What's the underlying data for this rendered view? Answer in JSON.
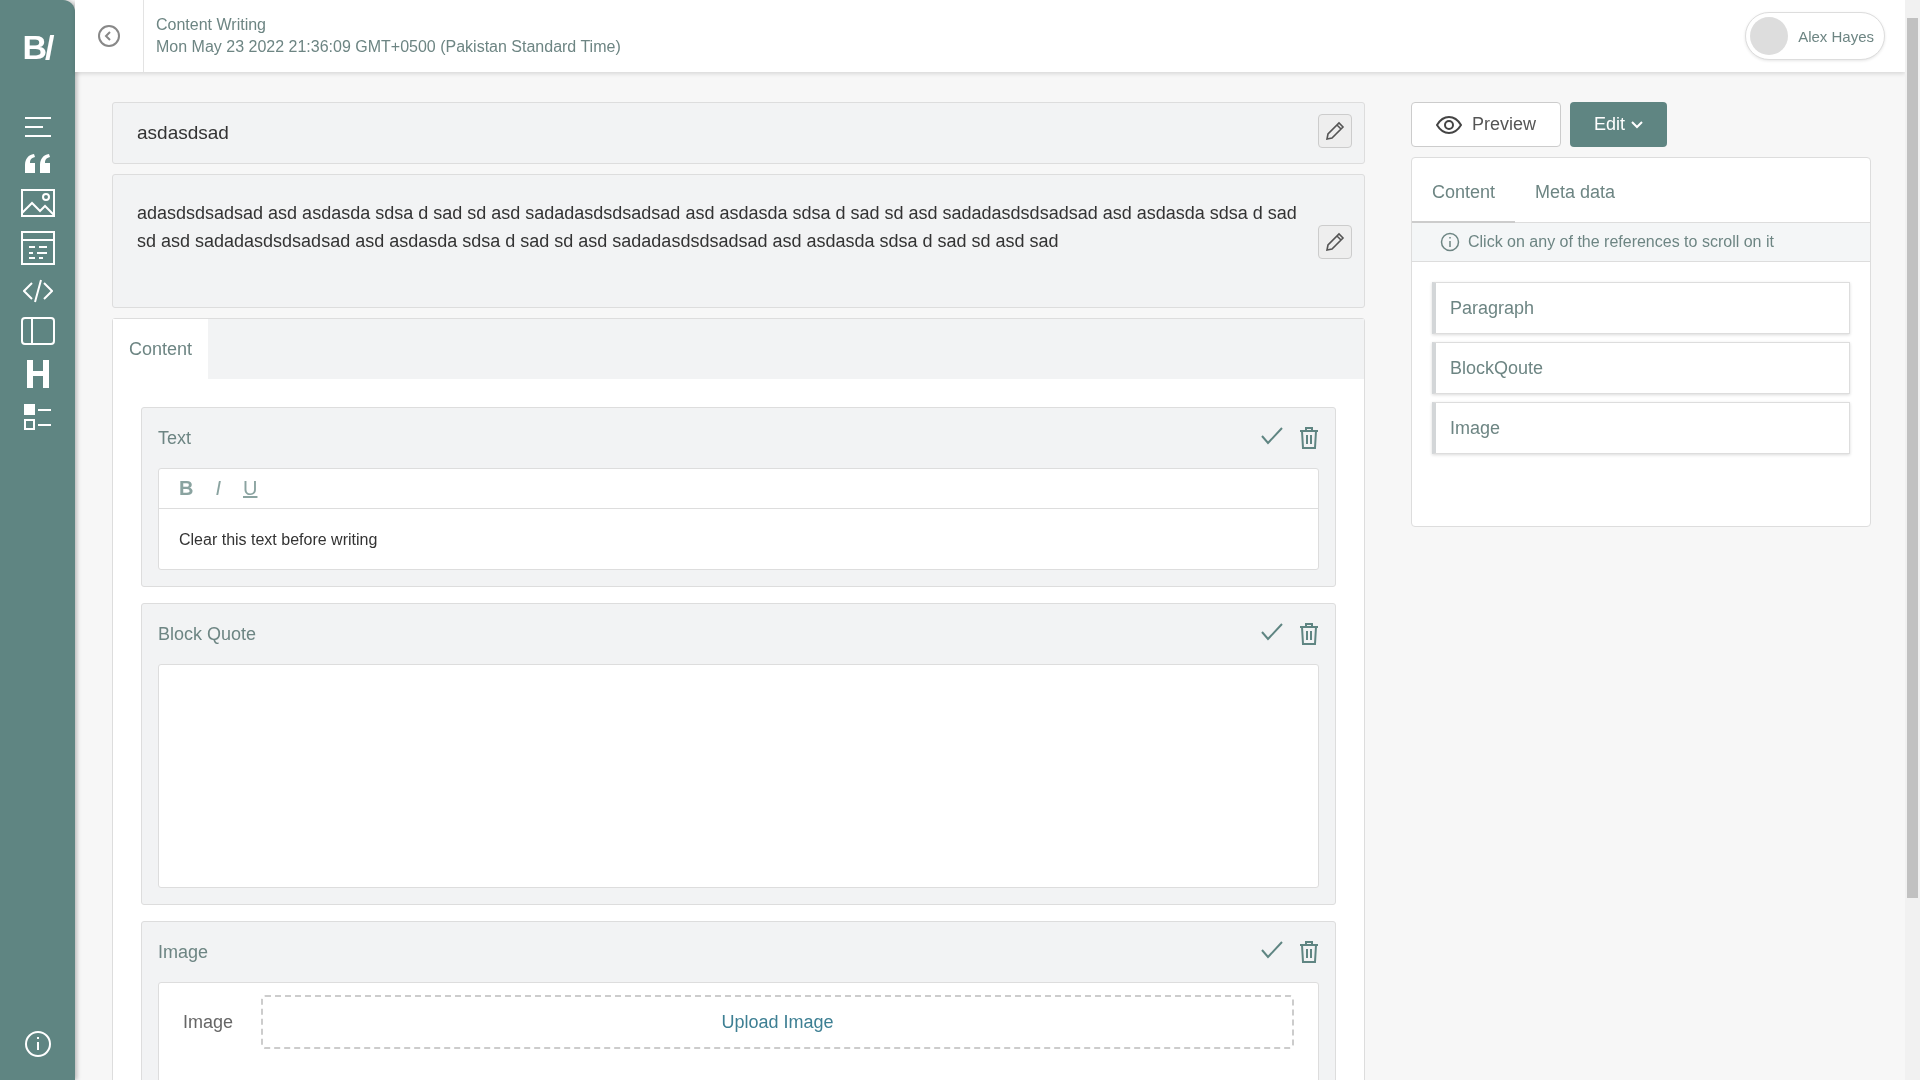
{
  "sidebar": {
    "logo": "B/"
  },
  "header": {
    "title": "Content Writing",
    "timestamp": "Mon May 23 2022 21:36:09 GMT+0500 (Pakistan Standard Time)",
    "user": "Alex Hayes"
  },
  "document": {
    "title": "asdasdsad",
    "description": "adasdsdsadsad asd asdasda sdsa d sad sd asd sadadasdsdsadsad asd asdasda sdsa d sad sd asd sadadasdsdsadsad asd asdasda sdsa d sad sd asd sadadasdsdsadsad asd asdasda sdsa d sad sd asd sadadasdsdsadsad asd asdasda sdsa d sad sd asd sad"
  },
  "editor_tabs": [
    {
      "label": "Content",
      "selected": true
    }
  ],
  "blocks": [
    {
      "kind": "text",
      "title": "Text",
      "format_buttons": [
        "B",
        "I",
        "U"
      ],
      "value": "Clear this text before writing"
    },
    {
      "kind": "quote",
      "title": "Block Quote"
    },
    {
      "kind": "image",
      "title": "Image",
      "field_label": "Image",
      "upload": "Upload Image"
    }
  ],
  "actions": {
    "preview": "Preview",
    "edit": "Edit"
  },
  "panel": {
    "tabs": [
      {
        "label": "Content",
        "selected": true
      },
      {
        "label": "Meta data",
        "selected": false
      }
    ],
    "hint": "Click on any of the references to scroll on it",
    "references": [
      "Paragraph",
      "BlockQoute",
      "Image"
    ]
  }
}
